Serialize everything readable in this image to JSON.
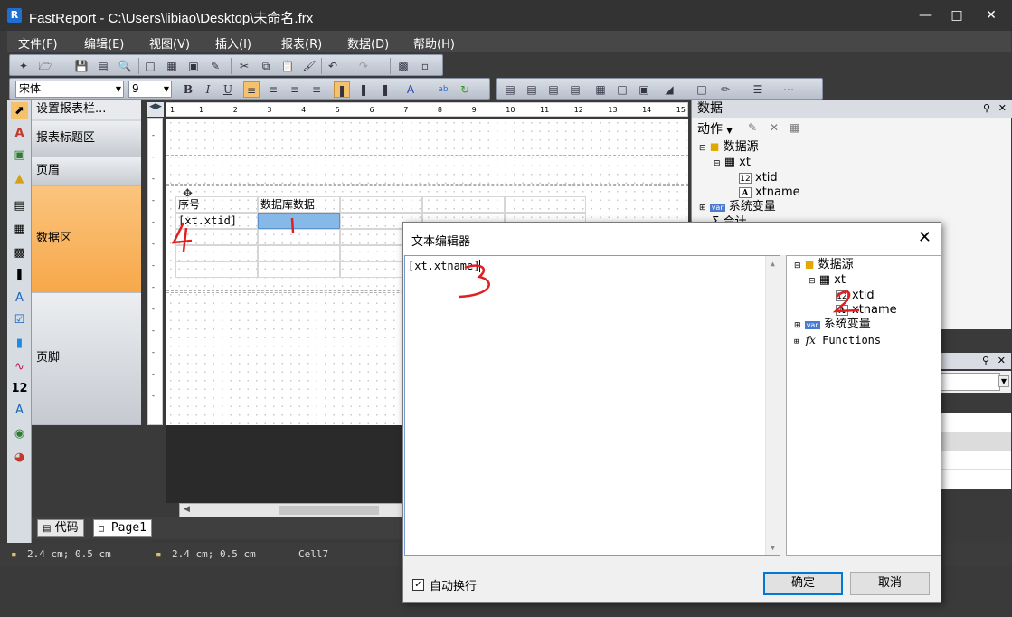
{
  "window": {
    "title": "FastReport - C:\\Users\\libiao\\Desktop\\未命名.frx",
    "app_icon": "R"
  },
  "menu": [
    "文件(F)",
    "编辑(E)",
    "视图(V)",
    "插入(I)",
    "报表(R)",
    "数据(D)",
    "帮助(H)"
  ],
  "format": {
    "font_name": "宋体",
    "font_size": "9",
    "bold": "B",
    "italic": "I",
    "underline": "U"
  },
  "bands": {
    "header_label": "设置报表栏...",
    "items": [
      "报表标题区",
      "页眉",
      "数据区",
      "页脚"
    ]
  },
  "ruler": [
    "1",
    "1",
    "2",
    "3",
    "4",
    "5",
    "6",
    "7",
    "8",
    "9",
    "10",
    "11",
    "12",
    "13",
    "14",
    "15"
  ],
  "table": {
    "headers": [
      "序号",
      "数据库数据"
    ],
    "row1": [
      "[xt.xtid]",
      ""
    ]
  },
  "data_panel": {
    "title": "数据",
    "action": "动作",
    "tree": {
      "root": "数据源",
      "table": "xt",
      "fields": [
        "xtid",
        "xtname"
      ],
      "sysvars": "系统变量",
      "totals": "合计"
    }
  },
  "page_tabs": [
    "代码",
    "Page1"
  ],
  "status": {
    "pos1": "2.4 cm; 0.5 cm",
    "pos2": "2.4 cm; 0.5 cm",
    "cell": "Cell7"
  },
  "dialog": {
    "title": "文本编辑器",
    "content": "[xt.xtname]",
    "tree": {
      "root": "数据源",
      "table": "xt",
      "fields": [
        "xtid",
        "xtname"
      ],
      "sysvars": "系统变量",
      "functions": "Functions"
    },
    "wordwrap_label": "自动换行",
    "wordwrap_checked": true,
    "ok": "确定",
    "cancel": "取消"
  },
  "annotations": [
    "1",
    "2",
    "3",
    "4"
  ],
  "colors": {
    "selected_band": "#f7a84a",
    "selected_cell": "#86b8e8",
    "red_ink": "#e02020"
  }
}
